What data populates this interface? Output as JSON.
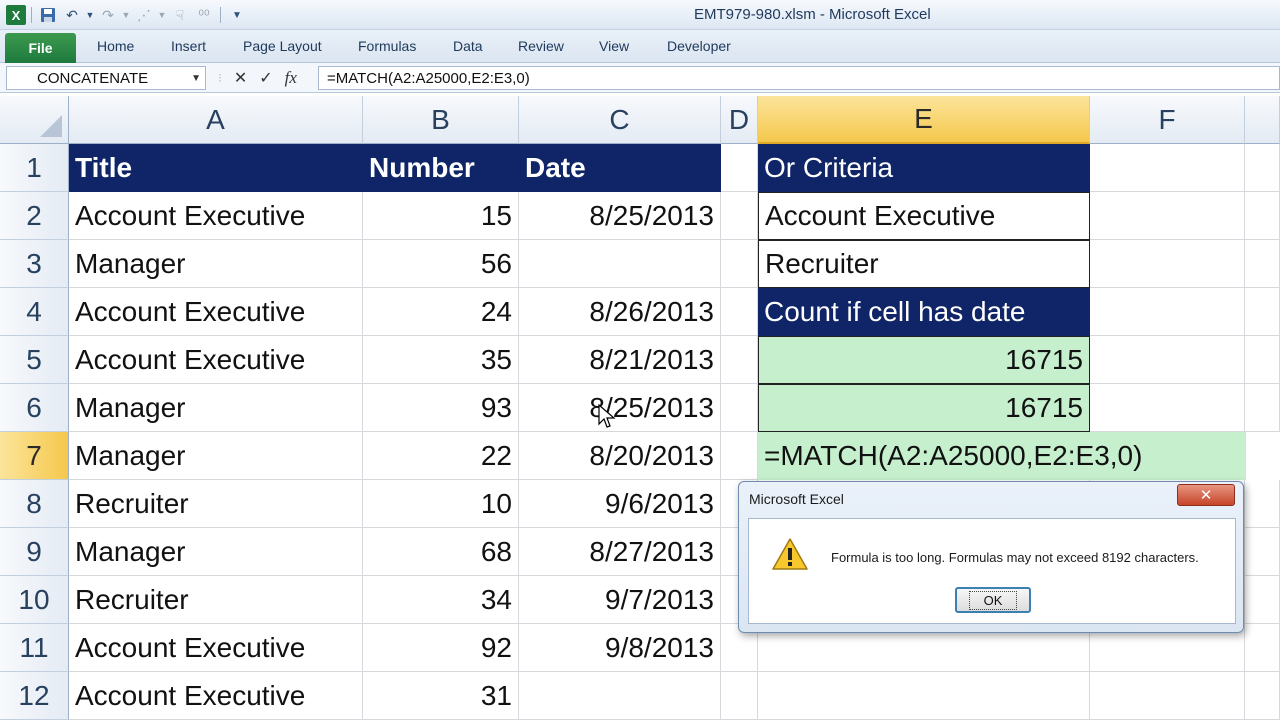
{
  "window": {
    "title": "EMT979-980.xlsm - Microsoft Excel"
  },
  "qat_icons": [
    "excel-logo-icon",
    "save-icon",
    "undo-icon",
    "redo-icon",
    "customize-icon"
  ],
  "ribbon": {
    "file": "File",
    "tabs": [
      "Home",
      "Insert",
      "Page Layout",
      "Formulas",
      "Data",
      "Review",
      "View",
      "Developer"
    ]
  },
  "formula_bar": {
    "name_box": "CONCATENATE",
    "cancel": "✕",
    "enter": "✓",
    "fx": "fx",
    "formula": "=MATCH(A2:A25000,E2:E3,0)"
  },
  "columns": [
    "A",
    "B",
    "C",
    "D",
    "E",
    "F"
  ],
  "rows": [
    "1",
    "2",
    "3",
    "4",
    "5",
    "6",
    "7",
    "8",
    "9",
    "10",
    "11",
    "12"
  ],
  "table": {
    "headers": [
      "Title",
      "Number",
      "Date"
    ],
    "data": [
      [
        "Account Executive",
        "15",
        "8/25/2013"
      ],
      [
        "Manager",
        "56",
        ""
      ],
      [
        "Account Executive",
        "24",
        "8/26/2013"
      ],
      [
        "Account Executive",
        "35",
        "8/21/2013"
      ],
      [
        "Manager",
        "93",
        "8/25/2013"
      ],
      [
        "Manager",
        "22",
        "8/20/2013"
      ],
      [
        "Recruiter",
        "10",
        "9/6/2013"
      ],
      [
        "Manager",
        "68",
        "8/27/2013"
      ],
      [
        "Recruiter",
        "34",
        "9/7/2013"
      ],
      [
        "Account Executive",
        "92",
        "9/8/2013"
      ],
      [
        "Account Executive",
        "31",
        ""
      ]
    ]
  },
  "criteria": {
    "header": "Or Criteria",
    "items": [
      "Account Executive",
      "Recruiter"
    ],
    "count_label": "Count if cell has date",
    "results": [
      "16715",
      "16715"
    ],
    "editing": "=MATCH(A2:A25000,E2:E3,0)"
  },
  "dialog": {
    "title": "Microsoft Excel",
    "message": "Formula is too long. Formulas may not exceed 8192 characters.",
    "ok": "OK",
    "close": "✕"
  },
  "colors": {
    "header_navy": "#0f2567",
    "green_fill": "#c6efcd",
    "selected_header": "#f5c84c",
    "file_tab": "#1f7a3d"
  }
}
